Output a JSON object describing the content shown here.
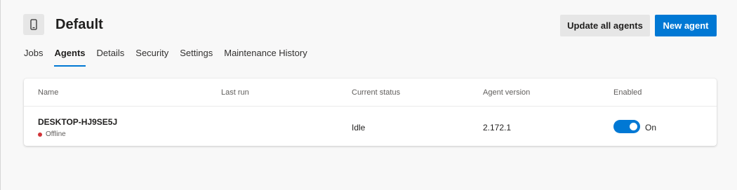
{
  "header": {
    "title": "Default",
    "icon": "phone-icon",
    "update_all_label": "Update all agents",
    "new_agent_label": "New agent",
    "primary_color": "#0078d4"
  },
  "tabs": [
    {
      "label": "Jobs",
      "active": false
    },
    {
      "label": "Agents",
      "active": true
    },
    {
      "label": "Details",
      "active": false
    },
    {
      "label": "Security",
      "active": false
    },
    {
      "label": "Settings",
      "active": false
    },
    {
      "label": "Maintenance History",
      "active": false
    }
  ],
  "table": {
    "columns": [
      "Name",
      "Last run",
      "Current status",
      "Agent version",
      "Enabled"
    ],
    "rows": [
      {
        "name": "DESKTOP-HJ9SE5J",
        "connection": "Offline",
        "connection_color": "#d13438",
        "last_run": "",
        "current_status": "Idle",
        "agent_version": "2.172.1",
        "enabled": true,
        "enabled_label": "On"
      }
    ]
  }
}
